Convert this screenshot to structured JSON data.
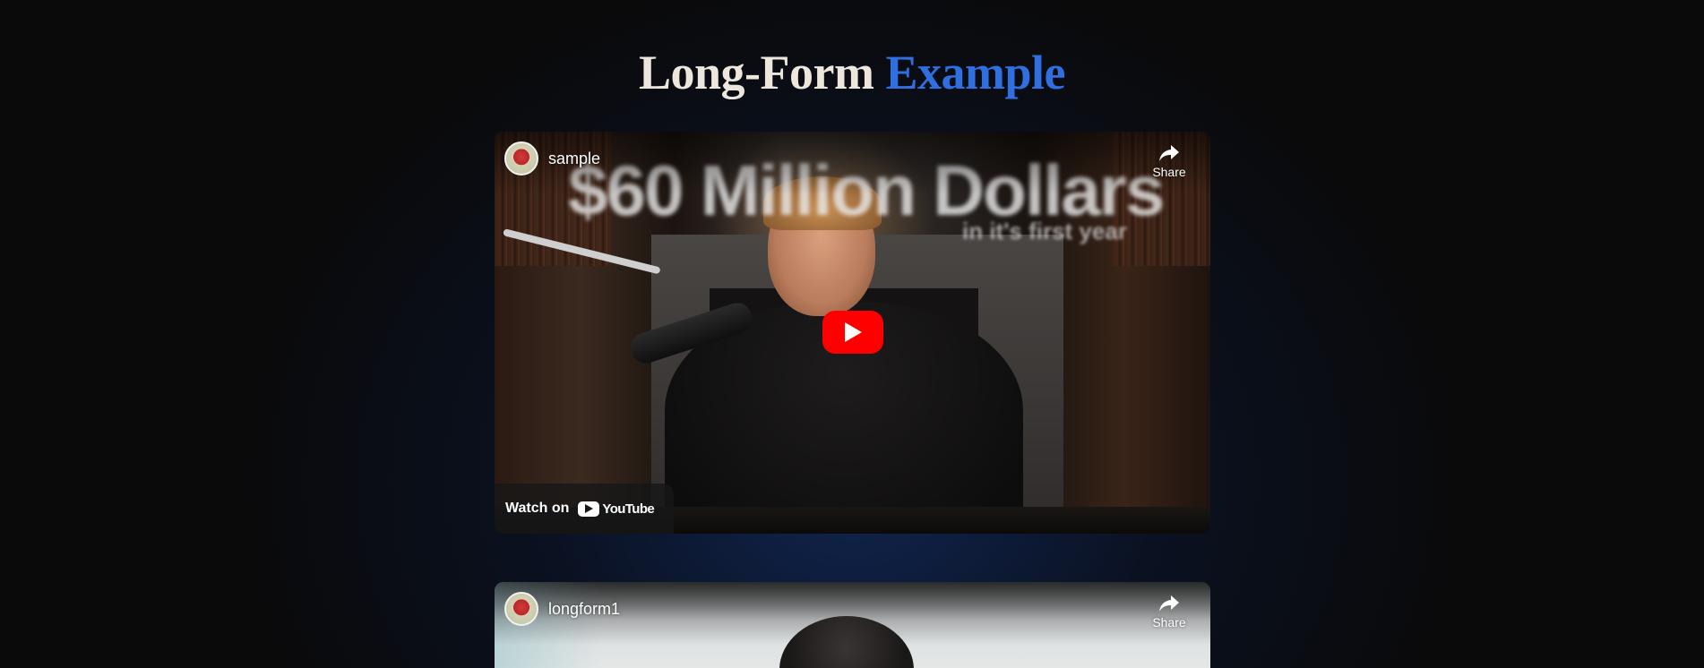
{
  "page": {
    "heading_main": "Long-Form",
    "heading_accent": "Example"
  },
  "colors": {
    "background": "#0a0a0b",
    "heading_text": "#ece6dc",
    "accent": "#2f6fe0",
    "play_red": "#ff0000"
  },
  "videos": [
    {
      "channel_name": "sample",
      "share_label": "Share",
      "thumbnail_title": "$60 Million Dollars",
      "thumbnail_subtitle": "in it's first year",
      "watch_on_label": "Watch on",
      "platform_name": "YouTube",
      "icons": [
        "channel-avatar",
        "share-icon",
        "play-icon",
        "youtube-logo-icon"
      ]
    },
    {
      "channel_name": "longform1",
      "share_label": "Share",
      "icons": [
        "channel-avatar",
        "share-icon"
      ]
    }
  ]
}
